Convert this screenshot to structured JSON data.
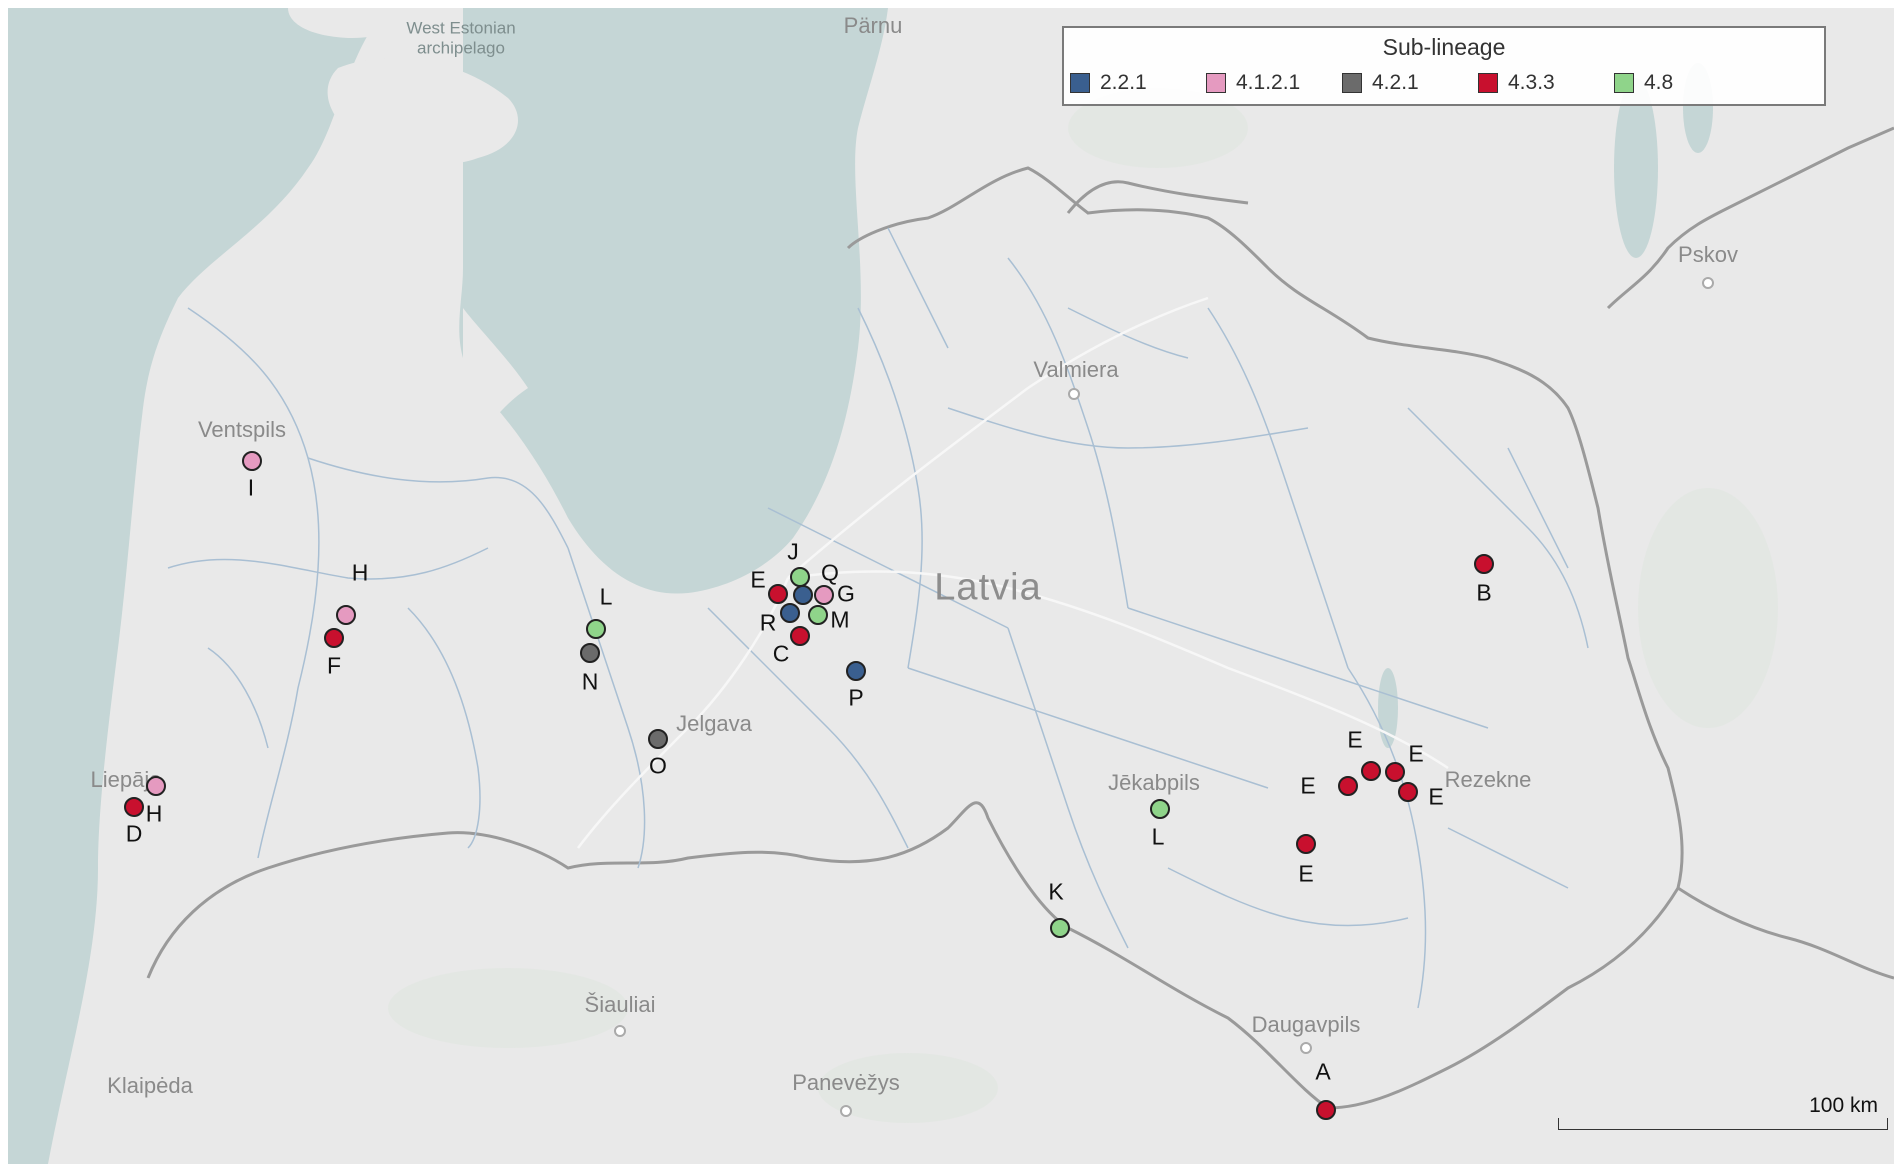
{
  "legend": {
    "title": "Sub-lineage",
    "items": [
      {
        "label": "2.2.1",
        "color": "#3a5f8f"
      },
      {
        "label": "4.1.2.1",
        "color": "#e59ac0"
      },
      {
        "label": "4.2.1",
        "color": "#6b6b6b"
      },
      {
        "label": "4.3.3",
        "color": "#c8102e"
      },
      {
        "label": "4.8",
        "color": "#8fd48a"
      }
    ]
  },
  "places": {
    "country": "Latvia",
    "sea": "West Estonian\narchipelago",
    "cities": [
      "Pärnu",
      "Pskov",
      "Valmiera",
      "Ventspils",
      "Jelgava",
      "Jēkabpils",
      "Rezekne",
      "Liepāja",
      "Šiauliai",
      "Daugavpils",
      "Panevėžys",
      "Klaipėda"
    ]
  },
  "samples": [
    {
      "label": "J",
      "lineage": "4.8"
    },
    {
      "label": "Q",
      "lineage": "4.1.2.1"
    },
    {
      "label": "E",
      "lineage": "4.3.3"
    },
    {
      "label": "G",
      "lineage": "2.2.1"
    },
    {
      "label": "M",
      "lineage": "4.8"
    },
    {
      "label": "R",
      "lineage": "2.2.1"
    },
    {
      "label": "C",
      "lineage": "4.3.3"
    },
    {
      "label": "P",
      "lineage": "2.2.1"
    },
    {
      "label": "I",
      "lineage": "4.1.2.1"
    },
    {
      "label": "H",
      "lineage": "4.1.2.1"
    },
    {
      "label": "F",
      "lineage": "4.3.3"
    },
    {
      "label": "L",
      "lineage": "4.8"
    },
    {
      "label": "N",
      "lineage": "4.2.1"
    },
    {
      "label": "O",
      "lineage": "4.2.1"
    },
    {
      "label": "H",
      "lineage": "4.1.2.1"
    },
    {
      "label": "D",
      "lineage": "4.3.3"
    },
    {
      "label": "B",
      "lineage": "4.3.3"
    },
    {
      "label": "E",
      "lineage": "4.3.3"
    },
    {
      "label": "E",
      "lineage": "4.3.3"
    },
    {
      "label": "E",
      "lineage": "4.3.3"
    },
    {
      "label": "E",
      "lineage": "4.3.3"
    },
    {
      "label": "E",
      "lineage": "4.3.3"
    },
    {
      "label": "L",
      "lineage": "4.8"
    },
    {
      "label": "K",
      "lineage": "4.8"
    },
    {
      "label": "A",
      "lineage": "4.3.3"
    }
  ],
  "scale": {
    "label": "100 km"
  }
}
